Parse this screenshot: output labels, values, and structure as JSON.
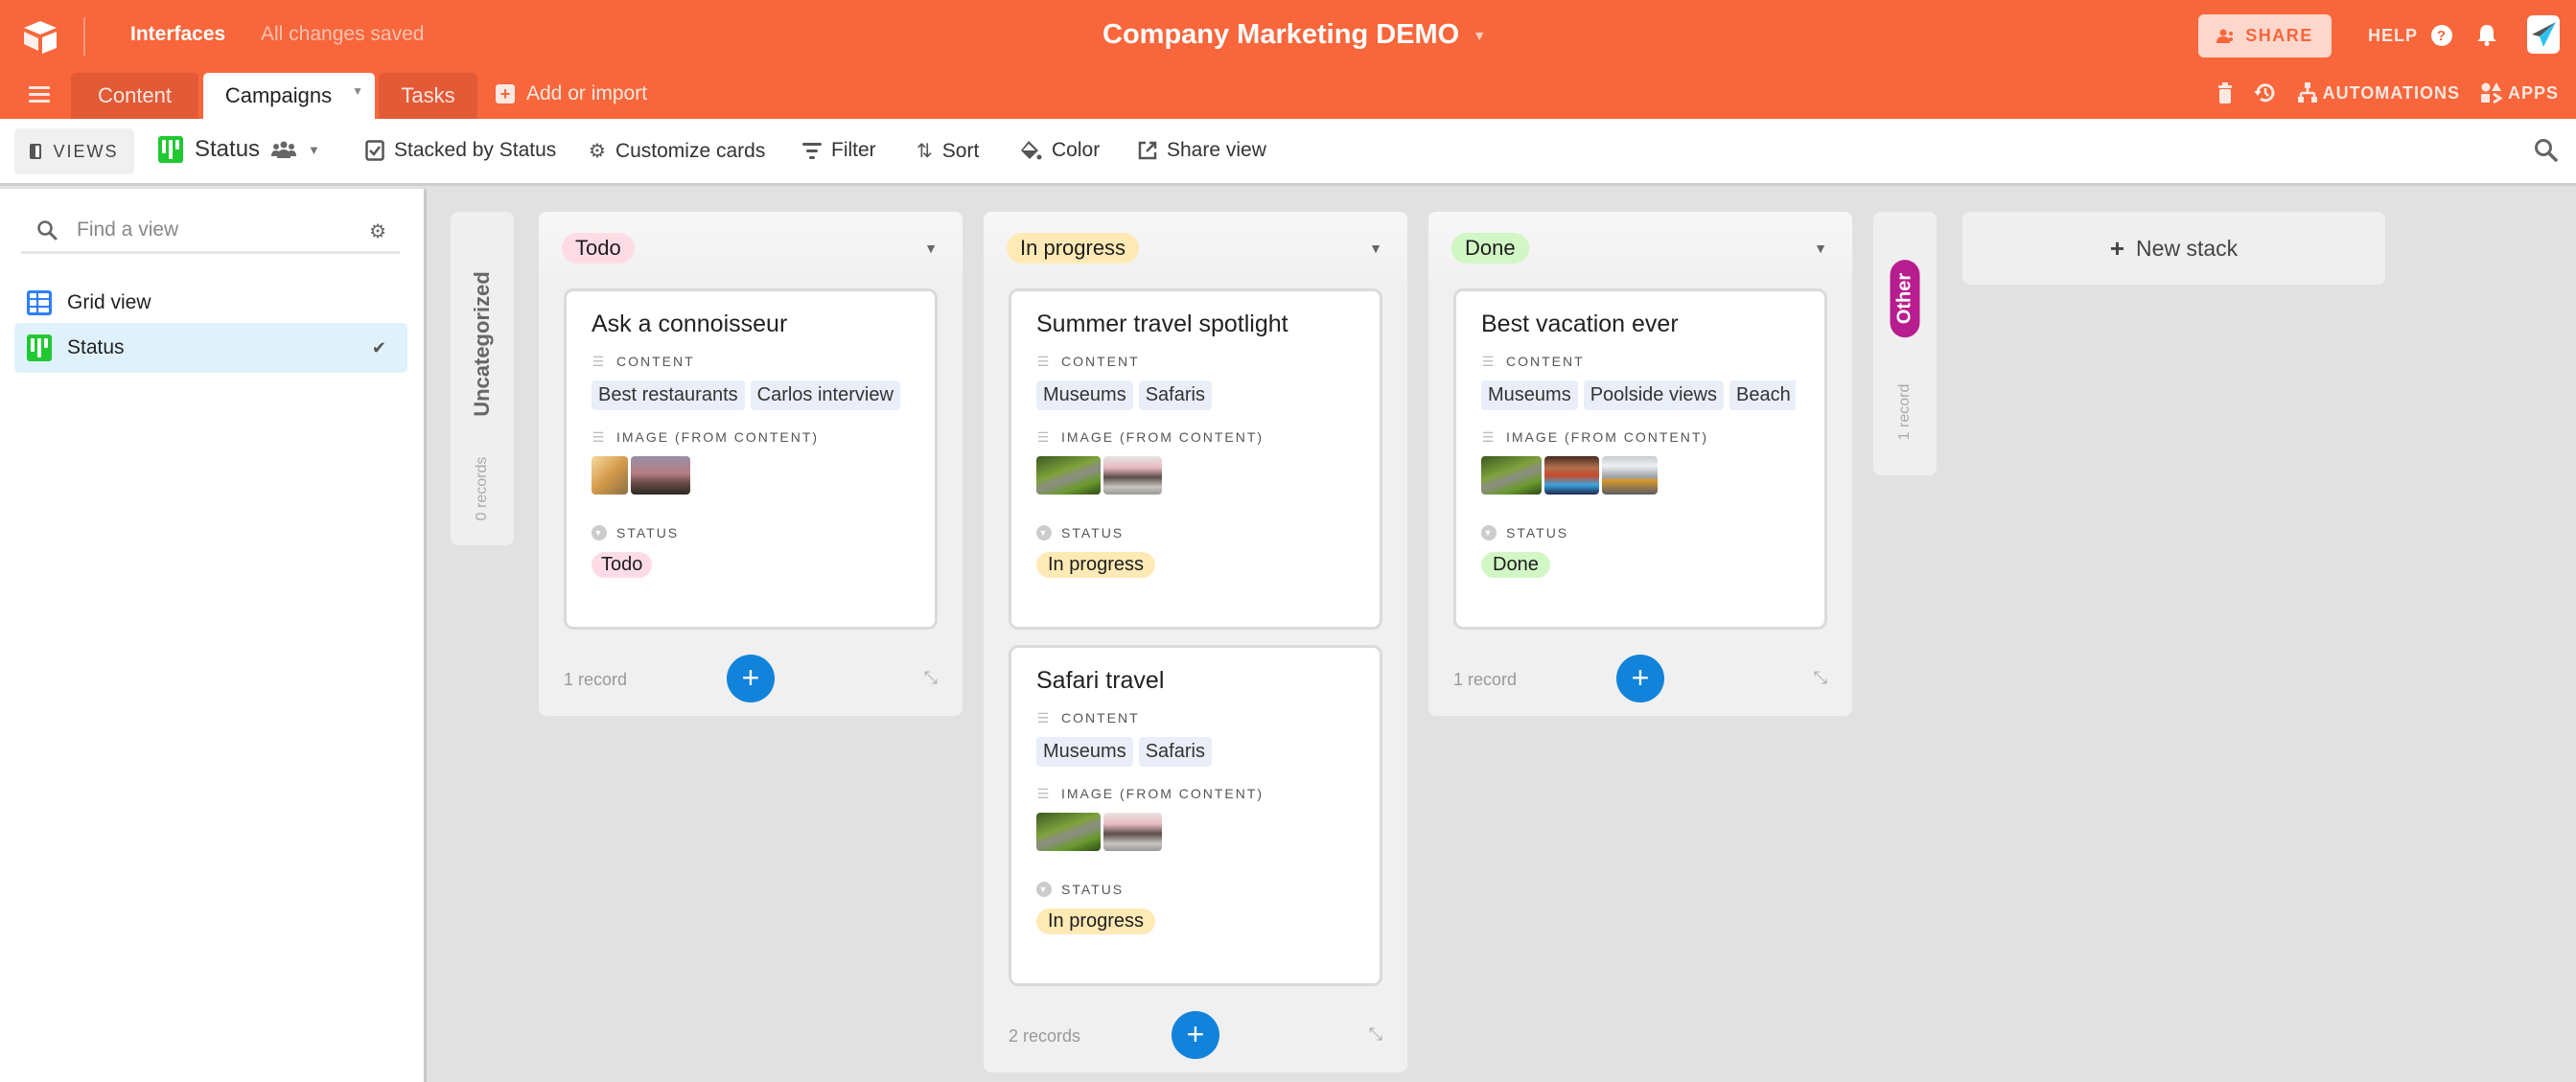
{
  "header": {
    "logo_icon": "airtable-logo-icon",
    "interfaces_label": "Interfaces",
    "save_status": "All changes saved",
    "base_title": "Company Marketing DEMO",
    "share_label": "SHARE",
    "help_label": "HELP",
    "brand_color": "#f8663b"
  },
  "tabs": [
    {
      "label": "Content",
      "active": false
    },
    {
      "label": "Campaigns",
      "active": true
    },
    {
      "label": "Tasks",
      "active": false
    }
  ],
  "add_import_label": "Add or import",
  "right_tools": {
    "automations_label": "AUTOMATIONS",
    "apps_label": "APPS"
  },
  "viewbar": {
    "views_label": "VIEWS",
    "current_view": "Status",
    "tools": [
      {
        "label": "Stacked by Status",
        "icon": "checkbox-icon"
      },
      {
        "label": "Customize cards",
        "icon": "gear-icon"
      },
      {
        "label": "Filter",
        "icon": "filter-icon"
      },
      {
        "label": "Sort",
        "icon": "sort-icon"
      },
      {
        "label": "Color",
        "icon": "paint-bucket-icon"
      },
      {
        "label": "Share view",
        "icon": "share-icon"
      }
    ]
  },
  "sidebar": {
    "search_placeholder": "Find a view",
    "items": [
      {
        "label": "Grid view",
        "type": "grid",
        "active": false
      },
      {
        "label": "Status",
        "type": "kanban",
        "active": true
      }
    ]
  },
  "board": {
    "uncategorized": {
      "label": "Uncategorized",
      "count": "0 records"
    },
    "field_labels": {
      "content": "CONTENT",
      "image": "IMAGE (FROM CONTENT)",
      "status": "STATUS"
    },
    "stacks": [
      {
        "name": "Todo",
        "count": "1 record",
        "cards": [
          {
            "title": "Ask a connoisseur",
            "content": [
              "Best restaurants",
              "Carlos interview"
            ],
            "images": 2,
            "status": "Todo"
          }
        ]
      },
      {
        "name": "In progress",
        "count": "2 records",
        "cards": [
          {
            "title": "Summer travel spotlight",
            "content": [
              "Museums",
              "Safaris"
            ],
            "images": 2,
            "status": "In progress"
          },
          {
            "title": "Safari travel",
            "content": [
              "Museums",
              "Safaris"
            ],
            "images": 2,
            "status": "In progress"
          }
        ]
      },
      {
        "name": "Done",
        "count": "1 record",
        "cards": [
          {
            "title": "Best vacation ever",
            "content": [
              "Museums",
              "Poolside views",
              "Beach e"
            ],
            "images": 3,
            "status": "Done"
          }
        ]
      }
    ],
    "other": {
      "label": "Other",
      "count": "1 record",
      "color": "#b81d8f"
    },
    "new_stack_label": "New stack",
    "status_colors": {
      "Todo": "#ffdce5",
      "In progress": "#ffeab6",
      "Done": "#d1f7c4"
    }
  }
}
